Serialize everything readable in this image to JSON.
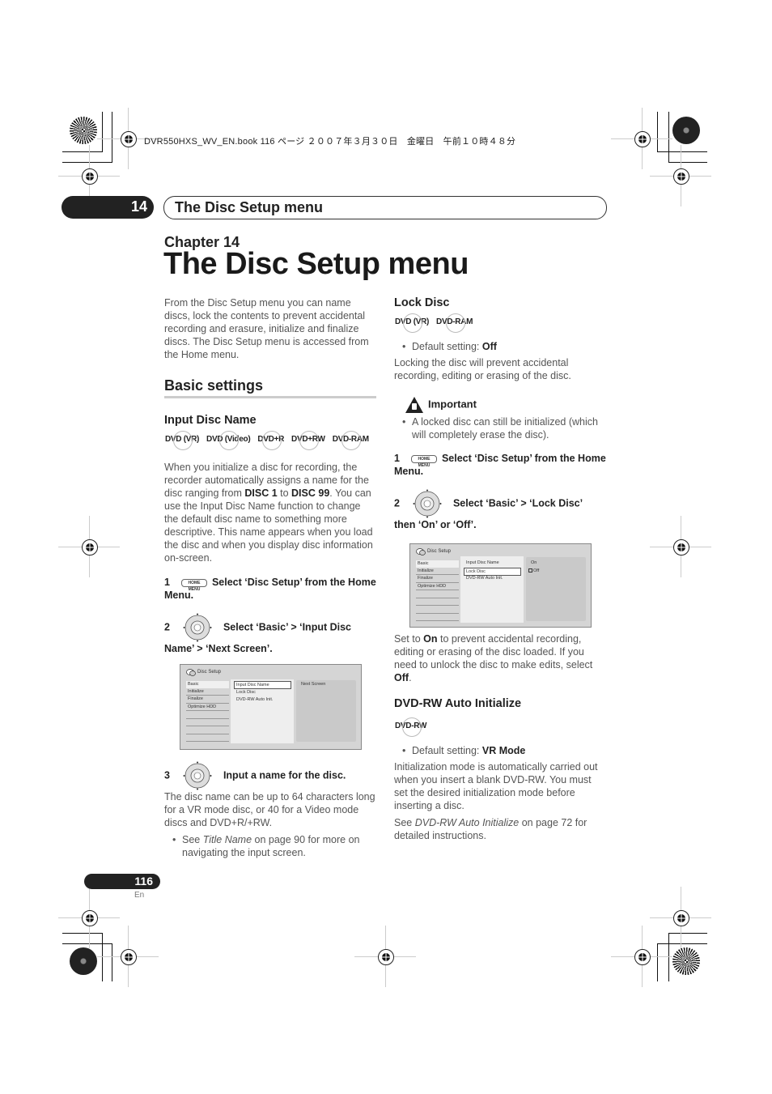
{
  "print_header": {
    "meta_text": "DVR550HXS_WV_EN.book 116 ページ ２００７年３月３０日　金曜日　午前１０時４８分"
  },
  "running_header": {
    "chapter_number": "14",
    "section_title": "The Disc Setup menu"
  },
  "chapter": {
    "label": "Chapter 14",
    "title": "The Disc Setup menu"
  },
  "left_column": {
    "intro": "From the Disc Setup menu you can name discs, lock the contents to prevent accidental recording and erasure, initialize and finalize discs. The Disc Setup menu is accessed from the Home menu.",
    "basic_settings_heading": "Basic settings",
    "input_disc_name": {
      "heading": "Input Disc Name",
      "badges": [
        "DVD (VR)",
        "DVD (Video)",
        "DVD+R",
        "DVD+RW",
        "DVD-RAM"
      ],
      "body_part1": "When you initialize a disc for recording, the recorder automatically assigns a name for the disc ranging from ",
      "disc_start": "DISC 1",
      "body_part2": " to ",
      "disc_end": "DISC 99",
      "body_part3": ". You can use the Input Disc Name function to change the default disc name to something more descriptive. This name appears when you load the disc and when you display disc information on-screen.",
      "steps": [
        {
          "number": "1",
          "icon": "home-menu-button",
          "icon_label": "HOME MENU",
          "text": "Select ‘Disc Setup’ from the Home Menu."
        },
        {
          "number": "2",
          "icon": "dpad",
          "text": "Select ‘Basic’ > ‘Input Disc Name’ > ‘Next Screen’."
        },
        {
          "number": "3",
          "icon": "dpad",
          "text": "Input a name for the disc."
        }
      ],
      "step3_body": "The disc name can be up to 64 characters long for a VR mode disc, or 40 for a Video mode discs and DVD+R/+RW.",
      "see_prefix": "See ",
      "see_ref": "Title Name",
      "see_suffix": " on page 90 for more on navigating the input screen.",
      "osd": {
        "title": "Disc Setup",
        "left_menu": [
          "Basic",
          "Initialize",
          "Finalize",
          "Optimize HDD",
          "",
          "",
          "",
          ""
        ],
        "left_selected": "Basic",
        "options": [
          "Input Disc Name",
          "Lock Disc",
          "DVD-RW Auto Init."
        ],
        "option_selected": "Input Disc Name",
        "right_values": [
          "Next Screen"
        ]
      }
    }
  },
  "right_column": {
    "lock_disc": {
      "heading": "Lock Disc",
      "badges": [
        "DVD (VR)",
        "DVD-RAM"
      ],
      "default_prefix": "Default setting: ",
      "default_value": "Off",
      "body": "Locking the disc will prevent accidental recording, editing or erasing of the disc.",
      "important_heading": "Important",
      "important_note": "A locked disc can still be initialized (which will completely erase the disc).",
      "steps": [
        {
          "number": "1",
          "icon": "home-menu-button",
          "icon_label": "HOME MENU",
          "text": "Select ‘Disc Setup’ from the Home Menu."
        },
        {
          "number": "2",
          "icon": "dpad",
          "text": "Select ‘Basic’ > ‘Lock Disc’ then ‘On’ or ‘Off’."
        }
      ],
      "osd": {
        "title": "Disc Setup",
        "left_menu": [
          "Basic",
          "Initialize",
          "Finalize",
          "Optimize HDD",
          "",
          "",
          "",
          ""
        ],
        "left_selected": "Basic",
        "options": [
          "Input Disc Name",
          "Lock Disc",
          "DVD-RW Auto Init."
        ],
        "option_selected": "Lock Disc",
        "right_values": [
          "On",
          "Off"
        ],
        "right_selected": "Off"
      },
      "after_p1": "Set to ",
      "after_on": "On",
      "after_p2": " to prevent accidental recording, editing or erasing of the disc loaded. If you need to unlock the disc to make edits, select ",
      "after_off": "Off",
      "after_p3": "."
    },
    "dvdrw_auto": {
      "heading": "DVD-RW Auto Initialize",
      "badges": [
        "DVD-RW"
      ],
      "default_prefix": "Default setting: ",
      "default_value": "VR Mode",
      "body": "Initialization mode is automatically carried out when you insert a blank DVD-RW. You must set the desired initialization mode before inserting a disc.",
      "see_prefix": "See ",
      "see_ref": "DVD-RW Auto Initialize",
      "see_suffix": " on page 72 for detailed instructions."
    }
  },
  "footer": {
    "page_number": "116",
    "language": "En"
  }
}
